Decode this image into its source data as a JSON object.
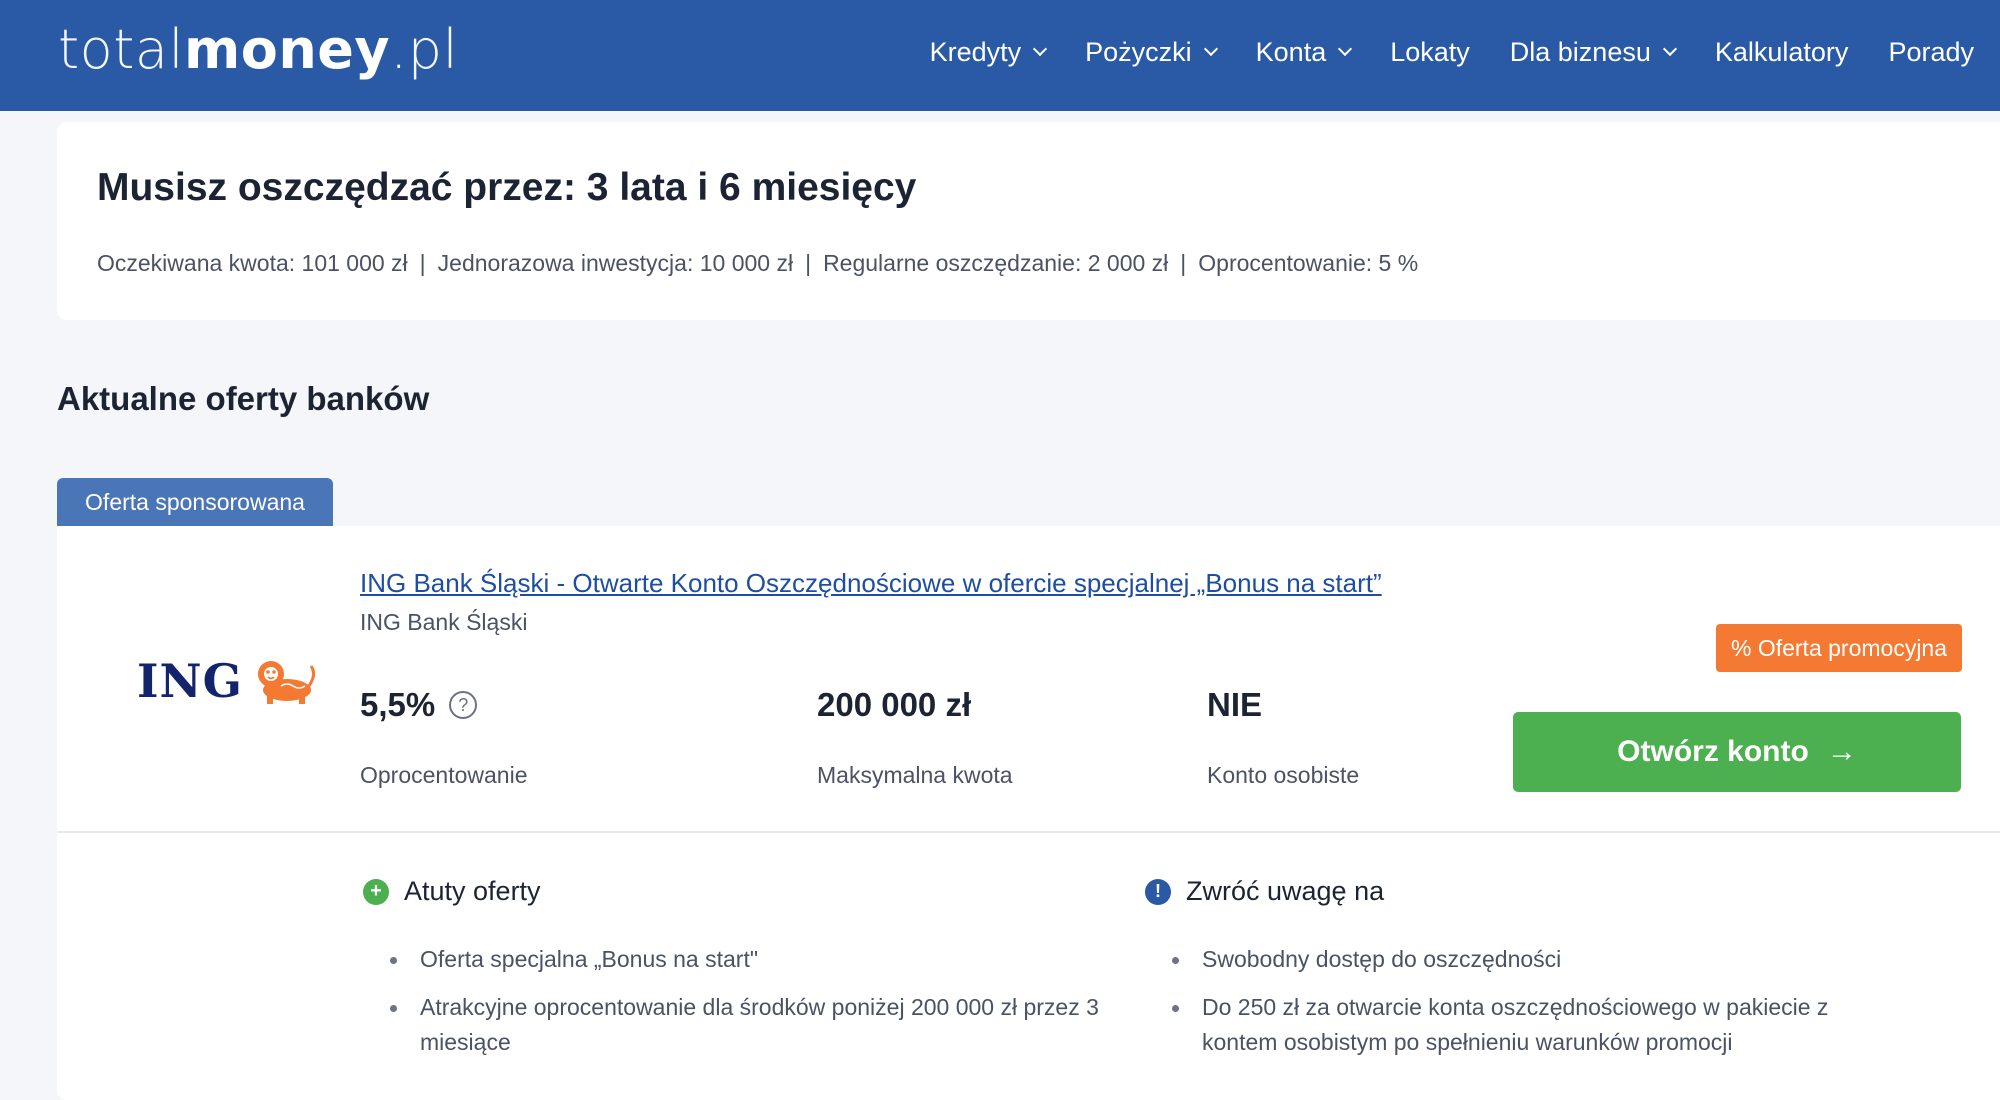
{
  "header": {
    "logo_light": "total",
    "logo_bold": "money",
    "logo_suffix": ".pl",
    "nav": [
      {
        "label": "Kredyty",
        "dropdown": true
      },
      {
        "label": "Pożyczki",
        "dropdown": true
      },
      {
        "label": "Konta",
        "dropdown": true
      },
      {
        "label": "Lokaty",
        "dropdown": false
      },
      {
        "label": "Dla biznesu",
        "dropdown": true
      },
      {
        "label": "Kalkulatory",
        "dropdown": false
      },
      {
        "label": "Porady",
        "dropdown": false
      }
    ]
  },
  "summary": {
    "title": "Musisz oszczędzać przez: 3 lata i 6 miesięcy",
    "params": [
      "Oczekiwana kwota: 101 000 zł",
      "Jednorazowa inwestycja: 10 000 zł",
      "Regularne oszczędzanie: 2 000 zł",
      "Oprocentowanie: 5 %"
    ],
    "separator": "|"
  },
  "section_title": "Aktualne oferty banków",
  "offer": {
    "sponsor_label": "Oferta sponsorowana",
    "logo_text": "ING",
    "title": "ING Bank Śląski - Otwarte Konto Oszczędnościowe w ofercie specjalnej „Bonus na start”",
    "bank": "ING Bank Śląski",
    "promo_badge": "% Oferta promocyjna",
    "metrics": [
      {
        "value": "5,5%",
        "label": "Oprocentowanie",
        "help": "?"
      },
      {
        "value": "200 000 zł",
        "label": "Maksymalna kwota"
      },
      {
        "value": "NIE",
        "label": "Konto osobiste"
      }
    ],
    "cta_label": "Otwórz konto",
    "cta_arrow": "→",
    "pros": {
      "icon": "+",
      "title": "Atuty oferty",
      "items": [
        "Oferta specjalna „Bonus na start\"",
        "Atrakcyjne oprocentowanie dla środków poniżej 200 000 zł przez 3 miesiące"
      ]
    },
    "cons": {
      "icon": "!",
      "title": "Zwróć uwagę na",
      "items": [
        "Swobodny dostęp do oszczędności",
        "Do 250 zł za otwarcie konta oszczędnościowego w pakiecie z kontem osobistym po spełnieniu warunków promocji"
      ]
    }
  },
  "colors": {
    "header_bg": "#2a5aa5",
    "link": "#1e4ea1",
    "cta": "#4caf50",
    "promo": "#f47a33",
    "ing_navy": "#13246d",
    "ing_orange": "#f47a33"
  }
}
